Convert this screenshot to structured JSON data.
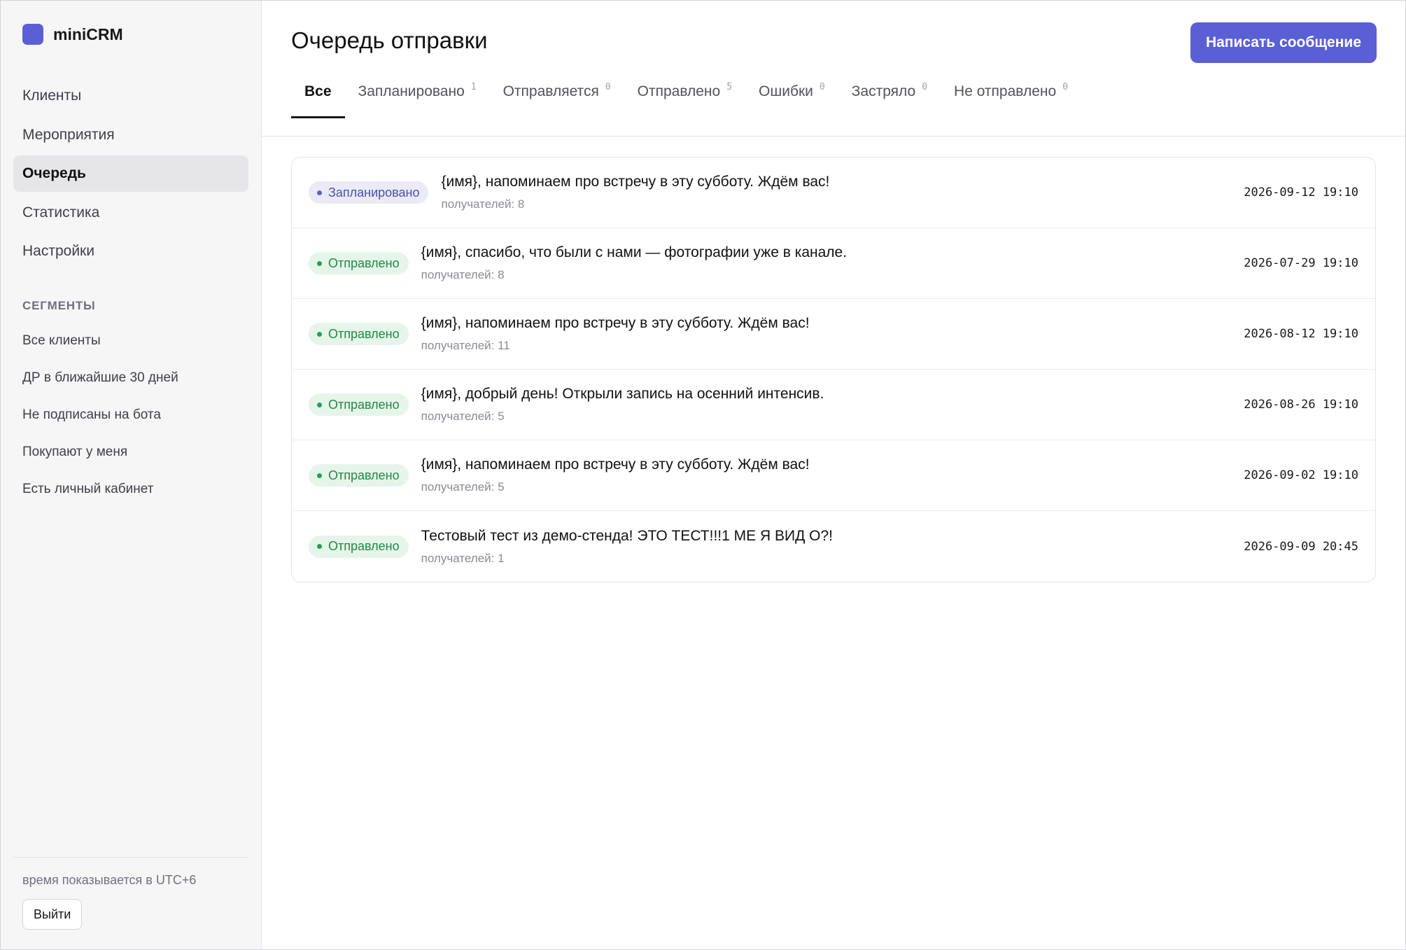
{
  "app": {
    "name": "miniCRM",
    "accent": "#5b5fd6"
  },
  "sidebar": {
    "nav": [
      {
        "label": "Клиенты",
        "active": false
      },
      {
        "label": "Мероприятия",
        "active": false
      },
      {
        "label": "Очередь",
        "active": true
      },
      {
        "label": "Статистика",
        "active": false
      },
      {
        "label": "Настройки",
        "active": false
      }
    ],
    "segments_title": "СЕГМЕНТЫ",
    "segments": [
      "Все клиенты",
      "ДР в ближайшие 30 дней",
      "Не подписаны на бота",
      "Покупают у меня",
      "Есть личный кабинет"
    ],
    "timezone_note": "время показывается в UTC+6",
    "logout_label": "Выйти"
  },
  "header": {
    "title": "Очередь отправки",
    "compose_label": "Написать сообщение"
  },
  "tabs": [
    {
      "label": "Все",
      "count": "",
      "active": true
    },
    {
      "label": "Запланировано",
      "count": "1",
      "active": false
    },
    {
      "label": "Отправляется",
      "count": "0",
      "active": false
    },
    {
      "label": "Отправлено",
      "count": "5",
      "active": false
    },
    {
      "label": "Ошибки",
      "count": "0",
      "active": false
    },
    {
      "label": "Застряло",
      "count": "0",
      "active": false
    },
    {
      "label": "Не отправлено",
      "count": "0",
      "active": false
    }
  ],
  "queue": [
    {
      "status": "Запланировано",
      "status_kind": "planned",
      "text": "{имя}, напоминаем про встречу в эту субботу. Ждём вас!",
      "recipients": "получателей: 8",
      "time": "2026-09-12 19:10"
    },
    {
      "status": "Отправлено",
      "status_kind": "sent",
      "text": "{имя}, спасибо, что были с нами — фотографии уже в канале.",
      "recipients": "получателей: 8",
      "time": "2026-07-29 19:10"
    },
    {
      "status": "Отправлено",
      "status_kind": "sent",
      "text": "{имя}, напоминаем про встречу в эту субботу. Ждём вас!",
      "recipients": "получателей: 11",
      "time": "2026-08-12 19:10"
    },
    {
      "status": "Отправлено",
      "status_kind": "sent",
      "text": "{имя}, добрый день! Открыли запись на осенний интенсив.",
      "recipients": "получателей: 5",
      "time": "2026-08-26 19:10"
    },
    {
      "status": "Отправлено",
      "status_kind": "sent",
      "text": "{имя}, напоминаем про встречу в эту субботу. Ждём вас!",
      "recipients": "получателей: 5",
      "time": "2026-09-02 19:10"
    },
    {
      "status": "Отправлено",
      "status_kind": "sent",
      "text": "Тестовый тест из демо-стенда! ЭТО ТЕСТ!!!1 МЕ Я ВИД О?!",
      "recipients": "получателей: 1",
      "time": "2026-09-09 20:45"
    }
  ]
}
